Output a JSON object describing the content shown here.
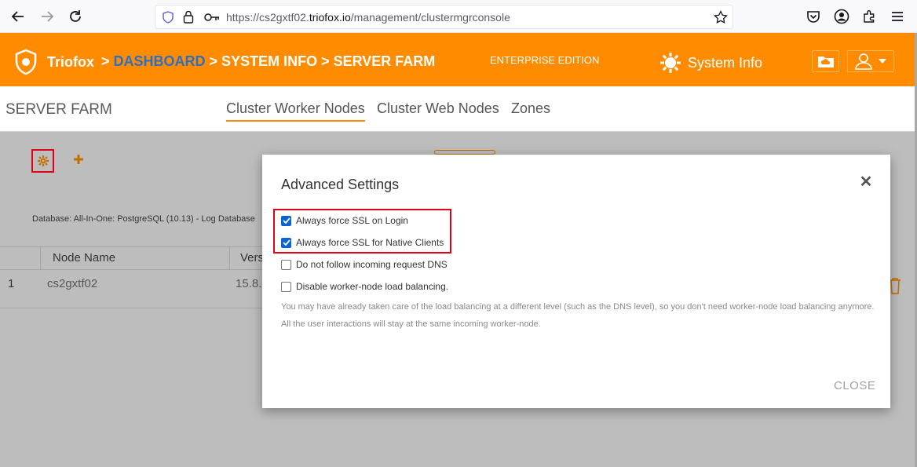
{
  "browser": {
    "url_prefix": "https://cs2gxtf02.",
    "url_host": "triofox.io",
    "url_path": "/management/clustermgrconsole"
  },
  "header": {
    "brand": "Triofox",
    "crumb_sep1": ">",
    "crumb_dashboard": "DASHBOARD",
    "crumb_rest": "> SYSTEM INFO > SERVER FARM",
    "edition": "ENTERPRISE EDITION",
    "system_info": "System Info"
  },
  "subheader": {
    "title": "SERVER FARM",
    "tabs": [
      {
        "label": "Cluster Worker Nodes",
        "active": true
      },
      {
        "label": "Cluster Web Nodes",
        "active": false
      },
      {
        "label": "Zones",
        "active": false
      }
    ]
  },
  "content": {
    "database_line": "Database: All-In-One: PostgreSQL (10.13) - Log Database",
    "table": {
      "headers": [
        "Node Name",
        "Vers"
      ],
      "rows": [
        {
          "index": "1",
          "name": "cs2gxtf02",
          "version": "15.8."
        }
      ]
    }
  },
  "modal": {
    "title": "Advanced Settings",
    "options": [
      {
        "label": "Always force SSL on Login",
        "checked": true
      },
      {
        "label": "Always force SSL for Native Clients",
        "checked": true
      },
      {
        "label": "Do not follow incoming request DNS",
        "checked": false
      },
      {
        "label": "Disable worker-node load balancing.",
        "checked": false
      }
    ],
    "note": "You may have already taken care of the load balancing at a different level (such as the DNS level), so you don't need worker-node load balancing anymore. All the user interactions will stay at the same incoming worker-node.",
    "close_label": "CLOSE"
  },
  "colors": {
    "brand_orange": "#ff8c00",
    "link_blue": "#2c6fc4",
    "highlight_red": "#e0001a",
    "checkbox_blue": "#0b64d6"
  }
}
